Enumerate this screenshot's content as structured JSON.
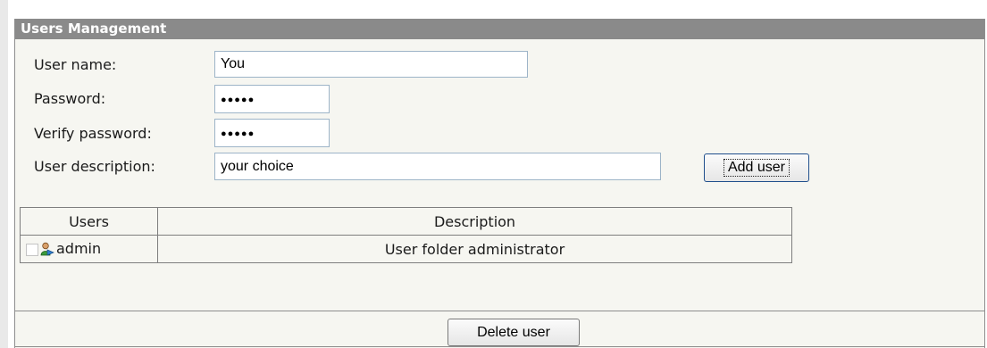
{
  "panel": {
    "title": "Users Management"
  },
  "form": {
    "username_label": "User name:",
    "username_value": "You",
    "password_label": "Password:",
    "password_value": "●●●●●",
    "verify_label": "Verify password:",
    "verify_value": "●●●●●",
    "description_label": "User description:",
    "description_value": "your choice",
    "add_button": "Add user"
  },
  "table": {
    "headers": [
      "Users",
      "Description"
    ],
    "rows": [
      {
        "user": "admin",
        "description": "User folder administrator",
        "checked": false,
        "icon": "user-admin-icon"
      }
    ]
  },
  "delete_button": "Delete user",
  "colors": {
    "header_bg": "#8a8a8a",
    "panel_bg": "#f6f6f1",
    "input_border": "#9db4c8"
  }
}
